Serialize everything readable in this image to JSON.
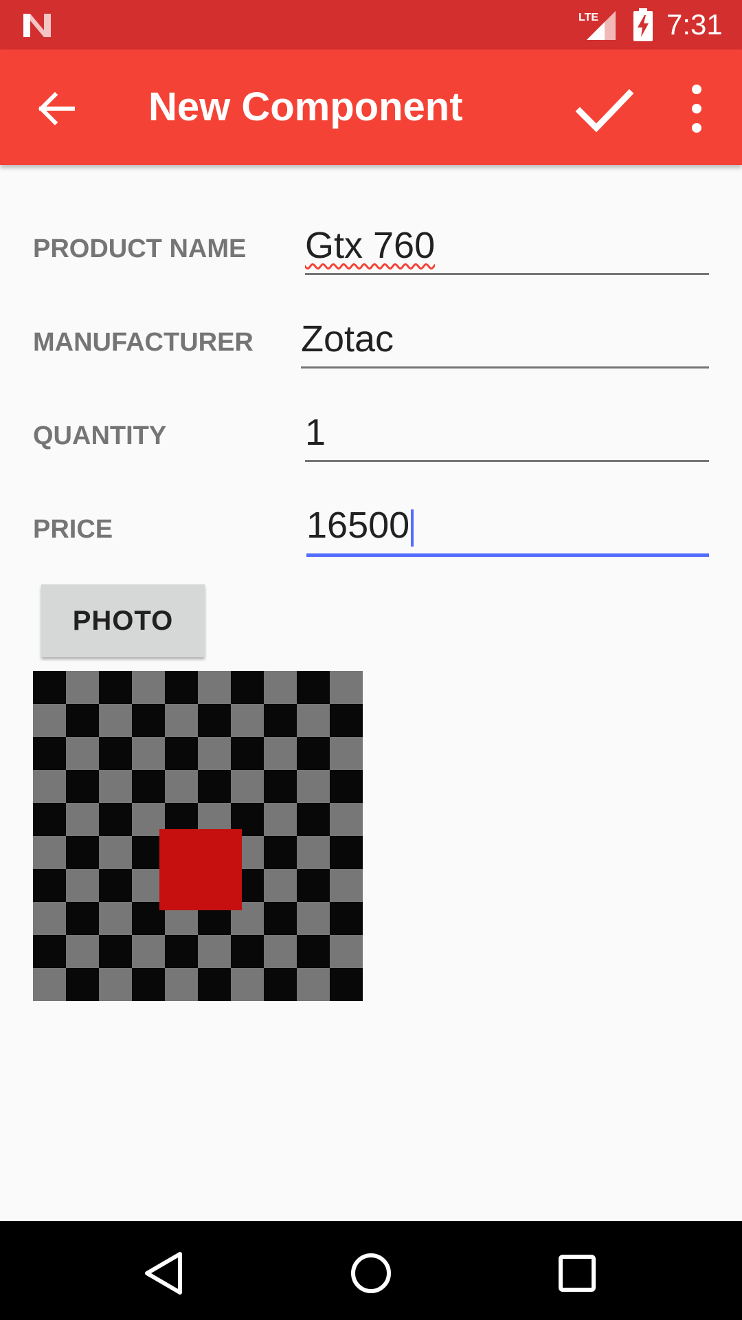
{
  "status_bar": {
    "time": "7:31",
    "network_label": "LTE",
    "icons": [
      "notification-n-icon",
      "lte-signal-icon",
      "battery-charging-icon"
    ],
    "background_color": "#d32f2f"
  },
  "app_bar": {
    "title": "New Component",
    "back_icon": "arrow-back-icon",
    "confirm_icon": "check-icon",
    "overflow_icon": "more-vert-icon",
    "background_color": "#f44336"
  },
  "form": {
    "product_name": {
      "label": "PRODUCT NAME",
      "value": "Gtx 760"
    },
    "manufacturer": {
      "label": "MANUFACTURER",
      "value": "Zotac"
    },
    "quantity": {
      "label": "QUANTITY",
      "value": "1"
    },
    "price": {
      "label": "PRICE",
      "value": "16500"
    }
  },
  "photo_button": {
    "label": "PHOTO"
  },
  "photo_preview": {
    "description_icon": "placeholder-image-icon",
    "checker_colors": [
      "#080808",
      "#777777"
    ],
    "center_square_color": "#c61010"
  },
  "accent_color": "#536dfe",
  "nav_bar": {
    "icons": [
      "back-triangle-icon",
      "home-circle-icon",
      "recents-square-icon"
    ]
  }
}
